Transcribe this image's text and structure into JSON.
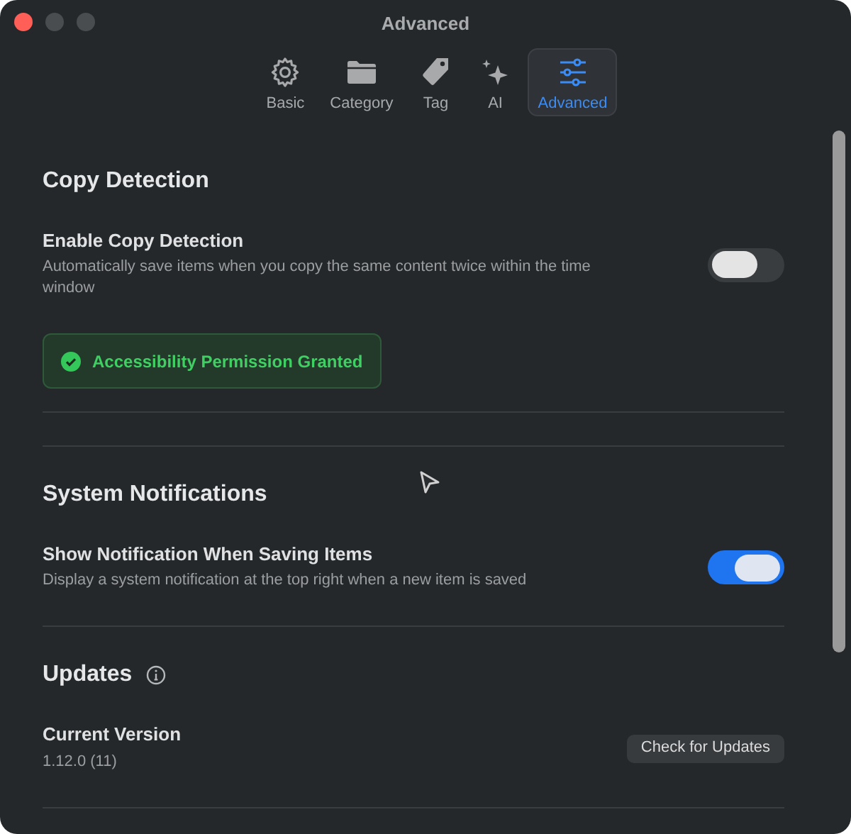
{
  "window": {
    "title": "Advanced"
  },
  "tabs": [
    {
      "label": "Basic",
      "kind": "gear",
      "selected": false
    },
    {
      "label": "Category",
      "kind": "folder",
      "selected": false
    },
    {
      "label": "Tag",
      "kind": "tag",
      "selected": false
    },
    {
      "label": "AI",
      "kind": "sparkles",
      "selected": false
    },
    {
      "label": "Advanced",
      "kind": "sliders",
      "selected": true
    }
  ],
  "sections": [
    {
      "title": "Copy Detection",
      "rows": [
        {
          "kind": "toggle",
          "label": "Enable Copy Detection",
          "description": "Automatically save items when you copy the same content twice within the time window",
          "on": false
        },
        {
          "kind": "status",
          "text": "Accessibility Permission Granted"
        }
      ]
    },
    {
      "title": "System Notifications",
      "rows": [
        {
          "kind": "toggle",
          "label": "Show Notification When Saving Items",
          "description": "Display a system notification at the top right when a new item is saved",
          "on": true
        }
      ]
    },
    {
      "title": "Updates",
      "info": true,
      "rows": [
        {
          "kind": "version",
          "label": "Current Version",
          "value": "1.12.0 (11)",
          "button": "Check for Updates"
        }
      ]
    }
  ]
}
